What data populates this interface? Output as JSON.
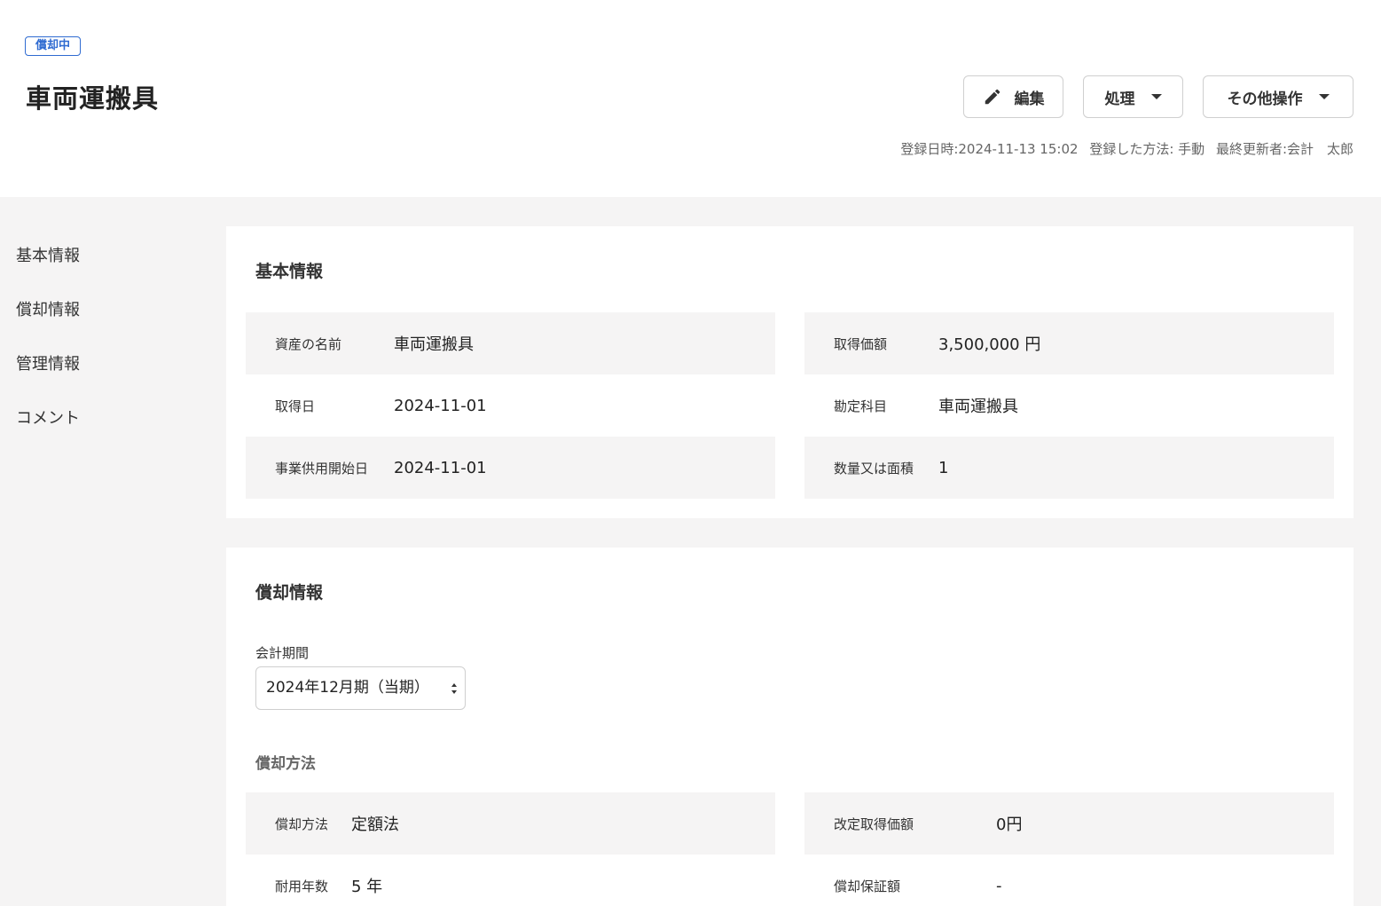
{
  "header": {
    "status_badge": "償却中",
    "title": "車両運搬具",
    "buttons": {
      "edit": "編集",
      "process": "処理",
      "more": "その他操作"
    },
    "meta": {
      "registered_at": "登録日時:2024-11-13 15:02",
      "registered_method": "登録した方法: 手動",
      "last_updated_by": "最終更新者:会計　太郎"
    }
  },
  "sidebar": {
    "items": [
      {
        "label": "基本情報"
      },
      {
        "label": "償却情報"
      },
      {
        "label": "管理情報"
      },
      {
        "label": "コメント"
      }
    ]
  },
  "basic_info": {
    "title": "基本情報",
    "left": [
      {
        "label": "資産の名前",
        "value": "車両運搬具"
      },
      {
        "label": "取得日",
        "value": "2024-11-01"
      },
      {
        "label": "事業供用開始日",
        "value": "2024-11-01"
      }
    ],
    "right": [
      {
        "label": "取得価額",
        "value": "3,500,000 円"
      },
      {
        "label": "勘定科目",
        "value": "車両運搬具"
      },
      {
        "label": "数量又は面積",
        "value": "1"
      }
    ]
  },
  "depreciation": {
    "title": "償却情報",
    "period_label": "会計期間",
    "period_value": "2024年12月期（当期）",
    "method_section_title": "償却方法",
    "left": [
      {
        "label": "償却方法",
        "value": "定額法"
      },
      {
        "label": "耐用年数",
        "value": "5 年"
      }
    ],
    "right": [
      {
        "label": "改定取得価額",
        "value": "0円"
      },
      {
        "label": "償却保証額",
        "value": "-"
      }
    ]
  },
  "colors": {
    "accent": "#2f6bd1",
    "background": "#f5f4f4",
    "card": "#ffffff"
  }
}
